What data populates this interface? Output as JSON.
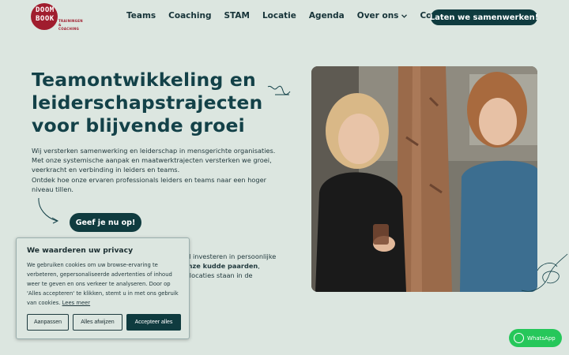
{
  "header": {
    "logo_line1": "DOOM",
    "logo_line2": "BOOK",
    "logo_sub": "TRAININGEN & COACHING",
    "nav": [
      {
        "label": "Teams"
      },
      {
        "label": "Coaching"
      },
      {
        "label": "STAM"
      },
      {
        "label": "Locatie"
      },
      {
        "label": "Agenda"
      },
      {
        "label": "Over ons",
        "has_dropdown": true
      },
      {
        "label": "Contact"
      }
    ],
    "cta": "Laten we samenwerken!"
  },
  "hero": {
    "title_lines": [
      "Teamontwikkeling en",
      "leiderschapstrajecten",
      "voor blijvende groei"
    ],
    "para1": "Wij versterken samenwerking en leiderschap in mensgerichte organisaties. Met onze systemische aanpak en maatwerktrajecten versterken we groei, veerkracht en verbinding in leiders en teams.",
    "para2": "Ontdek hoe onze ervaren professionals leiders en teams naar een hoger niveau tillen.",
    "donate": "Geef je nu op!",
    "partial_line1": "vil investeren in persoonlijke",
    "partial_line2_bold": "onze kudde paarden",
    "partial_line2_rest": ",",
    "partial_line3": "n locaties staan in de"
  },
  "cookie": {
    "title": "We waarderen uw privacy",
    "text": "We gebruiken cookies om uw browse-ervaring te verbeteren, gepersonaliseerde advertenties of inhoud weer te geven en ons verkeer te analyseren. Door op 'Alles accepteren' te klikken, stemt u in met ons gebruik van cookies.",
    "link": "Lees meer",
    "buttons": [
      "Aanpassen",
      "Alles afwijzen",
      "Accepteer alles"
    ]
  },
  "whatsapp": "WhatsApp",
  "colors": {
    "background": "#dce6e0",
    "primary": "#0f3b3f",
    "brand_red": "#a01d2e",
    "whatsapp": "#26c75a"
  }
}
